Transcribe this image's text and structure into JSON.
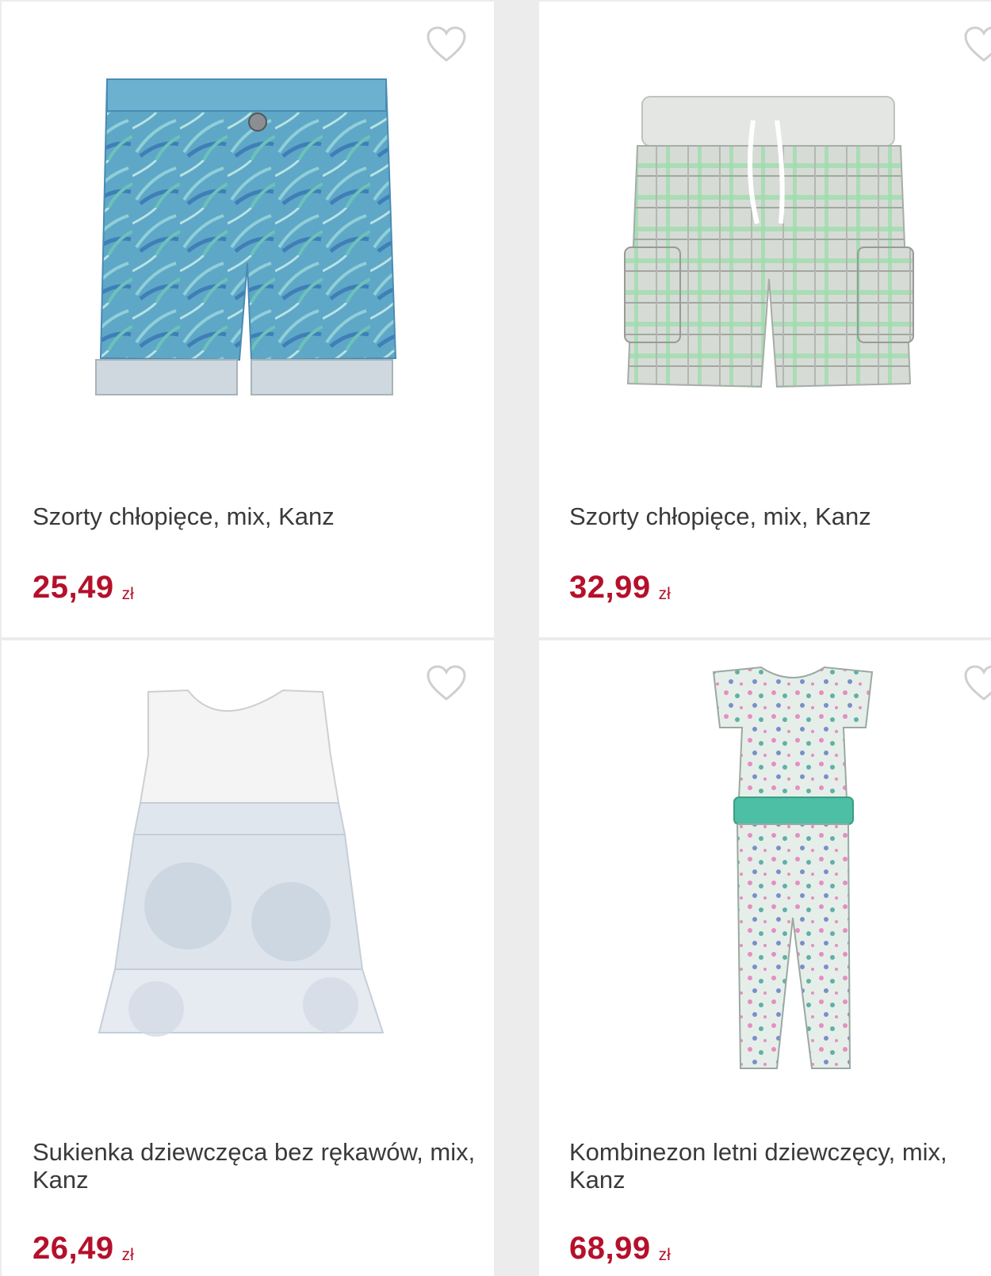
{
  "products": [
    {
      "title": "Szorty chłopięce, mix, Kanz",
      "price": "25,49",
      "currency": "zł",
      "image": "blue-palm-print-denim-shorts"
    },
    {
      "title": "Szorty chłopięce, mix, Kanz",
      "price": "32,99",
      "currency": "zł",
      "image": "grey-green-plaid-cargo-shorts"
    },
    {
      "title": "Sukienka dziewczęca bez rękawów, mix, Kanz",
      "price": "26,49",
      "currency": "zł",
      "image": "white-sleeveless-dress-blue-skirt"
    },
    {
      "title": "Kombinezon letni dziewczęcy, mix, Kanz",
      "price": "68,99",
      "currency": "zł",
      "image": "floral-jumpsuit-green-belt"
    }
  ],
  "icons": {
    "wishlist": "heart-outline-icon"
  },
  "colors": {
    "price": "#b5102b",
    "title": "#3a3a3a",
    "divider": "#ececec",
    "heart": "#cfcfcf"
  }
}
